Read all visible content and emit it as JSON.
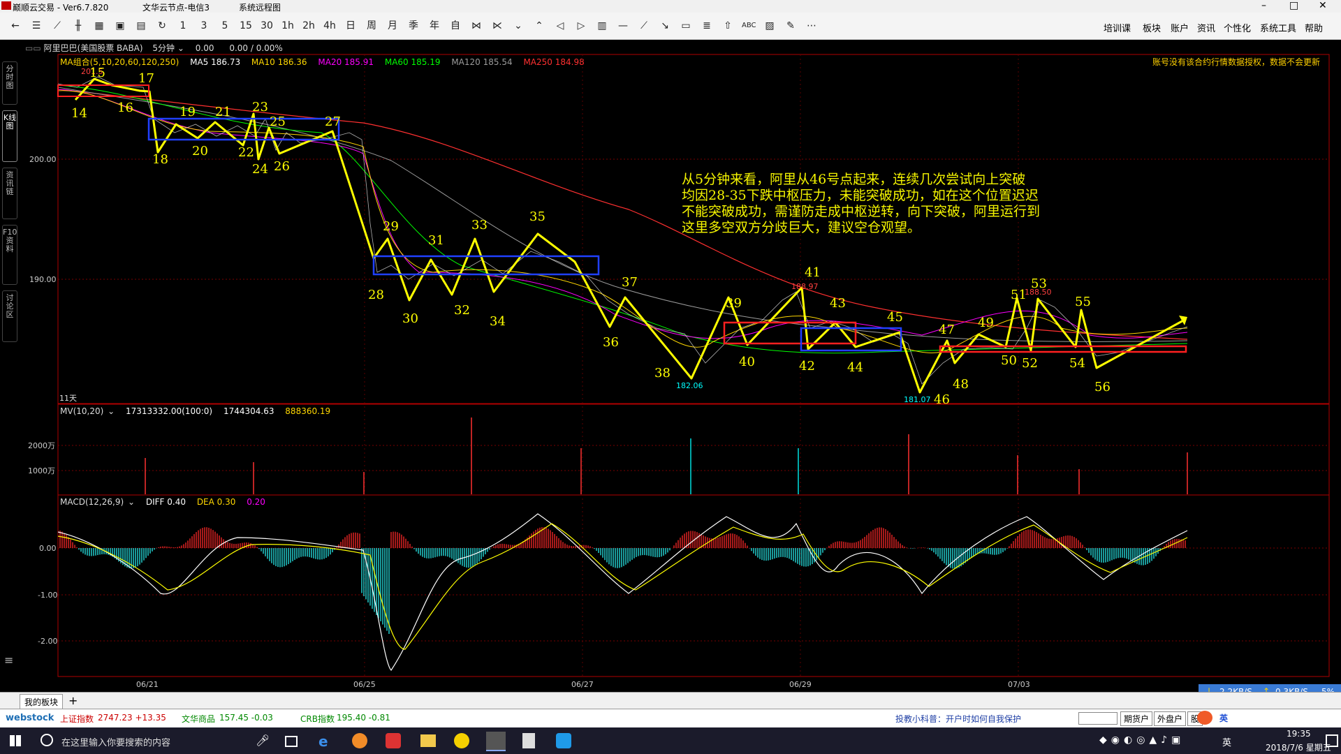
{
  "window": {
    "app_title": "巅顺云交易 - Ver6.7.820",
    "server": "文华云节点-电信3",
    "menu_system": "系统远程图",
    "controls": [
      "–",
      "□",
      "✕"
    ]
  },
  "toolbar": {
    "periods": [
      "1",
      "3",
      "5",
      "15",
      "30",
      "1h",
      "2h",
      "4h",
      "日",
      "周",
      "月",
      "季",
      "年",
      "自"
    ],
    "right_menu": [
      "培训课",
      "板块",
      "账户",
      "资讯",
      "个性化",
      "系统工具",
      "帮助"
    ]
  },
  "side_tabs": [
    "分时图",
    "K线图",
    "资讯链",
    "F10资料",
    "讨论区"
  ],
  "instrument": {
    "name": "阿里巴巴(美国股票 BABA)",
    "period": "5分钟",
    "price": "0.00",
    "change": "0.00 / 0.00%",
    "warning": "账号没有该合约行情数据授权，数据不会更新"
  },
  "ma": {
    "group": "MA组合(5,10,20,60,120,250)",
    "items": [
      {
        "label": "MA5 186.73",
        "color": "#ffffff"
      },
      {
        "label": "MA10 186.36",
        "color": "#ffd700"
      },
      {
        "label": "MA20 185.91",
        "color": "#ff00ff"
      },
      {
        "label": "MA60 185.19",
        "color": "#00ff00"
      },
      {
        "label": "MA120 185.54",
        "color": "#9b9b9b"
      },
      {
        "label": "MA250 184.98",
        "color": "#ff3030"
      }
    ]
  },
  "price_axis": [
    "200.00",
    "190.00"
  ],
  "annotation": {
    "text": "从5分钟来看，阿里从46号点起来，连续几次尝试向上突破\n均因28-35下跌中枢压力，未能突破成功，如在这个位置迟迟\n不能突破成功，需谨防走成中枢逆转，向下突破，阿里运行到\n这里多空双方分歧巨大，建议空仓观望。"
  },
  "chart_marks": {
    "high_1": "188.97",
    "high_2": "188.50",
    "low_1": "182.06",
    "low_2": "181.07",
    "days": "11天",
    "top_left": "201.5"
  },
  "mv": {
    "label": "MV(10,20)",
    "v1": "17313332.00(100:0)",
    "v2": "1744304.63",
    "v3": "888360.19",
    "axis": [
      "2000万",
      "1000万"
    ]
  },
  "macd": {
    "label": "MACD(12,26,9)",
    "diff": "DIFF 0.40",
    "dea": "DEA 0.30",
    "val": "0.20",
    "axis": [
      "0.00",
      "-1.00",
      "-2.00"
    ]
  },
  "dates": [
    "06/21",
    "06/25",
    "06/27",
    "06/29",
    "07/03"
  ],
  "bottom": {
    "tab": "我的板块",
    "add": "+",
    "webstock": "webstock",
    "sh_label": "上证指数",
    "sh_value": "2747.23 +13.35",
    "wh_label": "文华商品",
    "wh_value": "157.45 -0.03",
    "crb_label": "CRB指数",
    "crb_value": "195.40 -0.81",
    "tip": "投教小科普：开户时如何自我保护",
    "btn1": "期货户",
    "btn2": "外盘户",
    "btn3": "股",
    "ime": "英"
  },
  "net": {
    "down": "2.2KB/S",
    "up": "0.3KB/S",
    "pct": "5%"
  },
  "taskbar": {
    "search_placeholder": "在这里输入你要搜索的内容",
    "time": "19:35",
    "date": "2018/7/6 星期五",
    "lang": "英"
  },
  "point_labels": [
    "14",
    "15",
    "16",
    "17",
    "18",
    "19",
    "20",
    "21",
    "22",
    "23",
    "24",
    "25",
    "26",
    "27",
    "28",
    "29",
    "30",
    "31",
    "32",
    "33",
    "34",
    "35",
    "36",
    "37",
    "38",
    "39",
    "40",
    "41",
    "42",
    "43",
    "44",
    "45",
    "46",
    "47",
    "48",
    "49",
    "50",
    "51",
    "52",
    "53",
    "54",
    "55",
    "56"
  ]
}
